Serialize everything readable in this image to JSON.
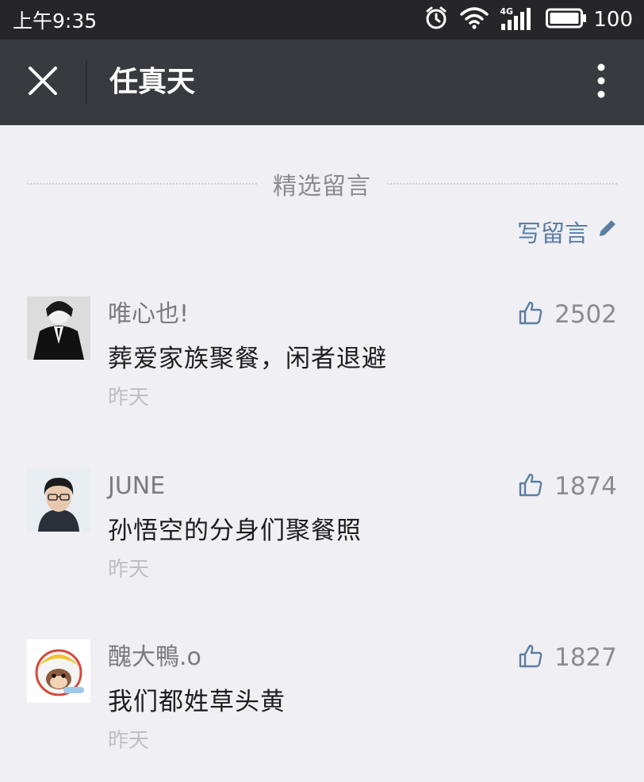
{
  "status_bar": {
    "time": "上午9:35",
    "battery": "100",
    "network": "4G"
  },
  "header": {
    "title": "任真天",
    "close_icon": "close-icon",
    "more_icon": "more-vertical-icon"
  },
  "section": {
    "title": "精选留言",
    "write_label": "写留言",
    "write_icon": "pencil-icon"
  },
  "comments": [
    {
      "nickname": "唯心也!",
      "text": "葬爱家族聚餐，闲者退避",
      "time": "昨天",
      "likes": "2502",
      "avatar": "avatar-suit-figure"
    },
    {
      "nickname": "JUNE",
      "text": "孙悟空的分身们聚餐照",
      "time": "昨天",
      "likes": "1874",
      "avatar": "avatar-person-glasses"
    },
    {
      "nickname": "醜大鴨.o",
      "text": "我们都姓草头黄",
      "time": "昨天",
      "likes": "1827",
      "avatar": "avatar-cartoon-helmet"
    }
  ],
  "colors": {
    "status_bar_bg": "#262629",
    "title_bar_bg": "#393a3f",
    "page_bg": "#efeff4",
    "link_blue": "#5c7ea3"
  }
}
